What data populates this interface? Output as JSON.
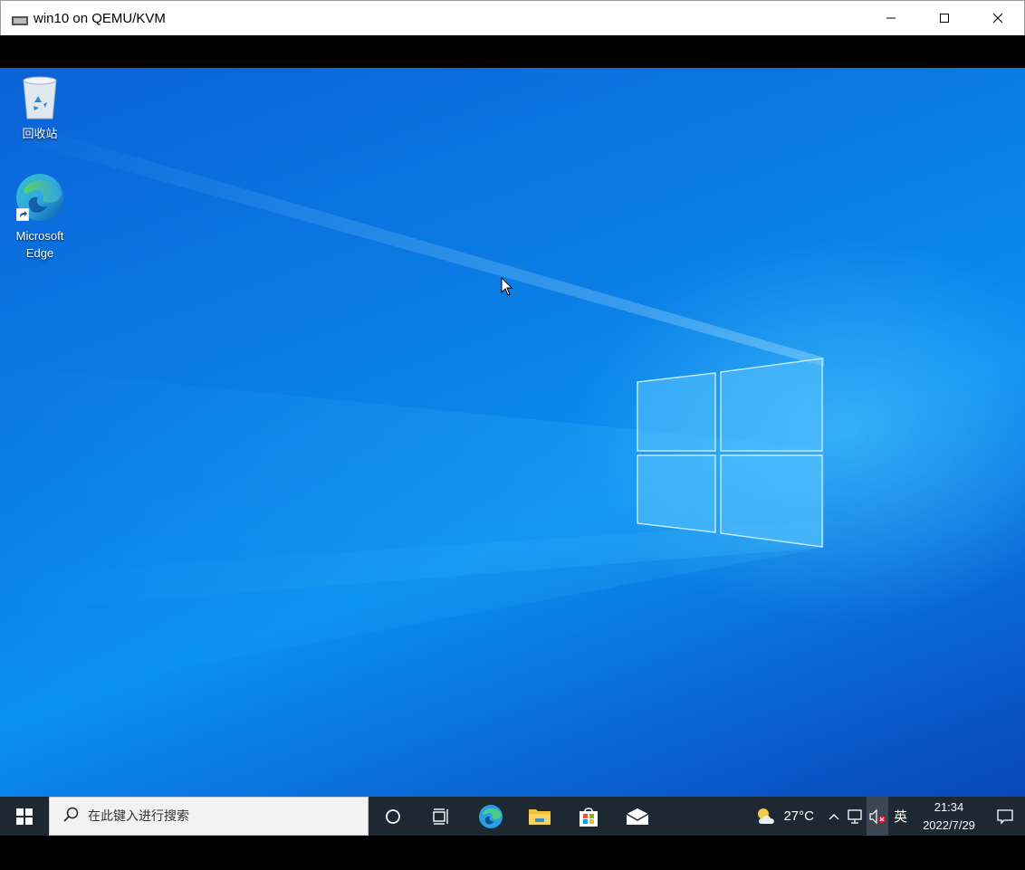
{
  "window": {
    "title": "win10 on QEMU/KVM",
    "controls": [
      "minimize",
      "maximize",
      "close"
    ]
  },
  "desktop": {
    "icons": [
      {
        "label": "回收站",
        "icon": "recycle-bin-icon"
      },
      {
        "label_line1": "Microsoft",
        "label_line2": "Edge",
        "icon": "edge-icon"
      }
    ]
  },
  "taskbar": {
    "search_placeholder": "在此键入进行搜索",
    "apps": [
      "cortana-icon",
      "task-view-icon",
      "edge-icon",
      "file-explorer-icon",
      "store-icon",
      "mail-icon"
    ],
    "weather_temp": "27°C",
    "ime": "英",
    "time": "21:34",
    "date": "2022/7/29"
  },
  "colors": {
    "taskbar_bg": "#1d2833",
    "desktop_accent": "#0a8ff0"
  }
}
